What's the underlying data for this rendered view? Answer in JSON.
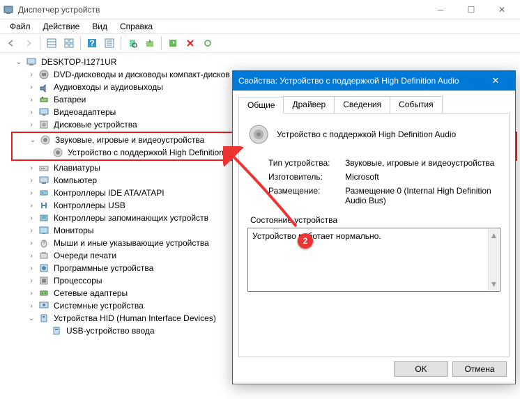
{
  "window": {
    "title": "Диспетчер устройств"
  },
  "menu": {
    "file": "Файл",
    "action": "Действие",
    "view": "Вид",
    "help": "Справка"
  },
  "tree": {
    "root": "DESKTOP-I1271UR",
    "items": [
      {
        "label": "DVD-дисководы и дисководы компакт-дисков"
      },
      {
        "label": "Аудиовходы и аудиовыходы"
      },
      {
        "label": "Батареи"
      },
      {
        "label": "Видеоадаптеры"
      },
      {
        "label": "Дисковые устройства"
      },
      {
        "label": "Звуковые, игровые и видеоустройства",
        "child": "Устройство с поддержкой High Definition Aud"
      },
      {
        "label": "Клавиатуры"
      },
      {
        "label": "Компьютер"
      },
      {
        "label": "Контроллеры IDE ATA/ATAPI"
      },
      {
        "label": "Контроллеры USB"
      },
      {
        "label": "Контроллеры запоминающих устройств"
      },
      {
        "label": "Мониторы"
      },
      {
        "label": "Мыши и иные указывающие устройства"
      },
      {
        "label": "Очереди печати"
      },
      {
        "label": "Программные устройства"
      },
      {
        "label": "Процессоры"
      },
      {
        "label": "Сетевые адаптеры"
      },
      {
        "label": "Системные устройства"
      },
      {
        "label": "Устройства HID (Human Interface Devices)",
        "child": "USB-устройство ввода"
      }
    ]
  },
  "dialog": {
    "title": "Свойства: Устройство с поддержкой High Definition Audio",
    "tabs": {
      "general": "Общие",
      "driver": "Драйвер",
      "details": "Сведения",
      "events": "События"
    },
    "device_name": "Устройство с поддержкой High Definition Audio",
    "props": {
      "type_k": "Тип устройства:",
      "type_v": "Звуковые, игровые и видеоустройства",
      "vendor_k": "Изготовитель:",
      "vendor_v": "Microsoft",
      "loc_k": "Размещение:",
      "loc_v": "Размещение 0 (Internal High Definition Audio Bus)"
    },
    "status_label": "Состояние устройства",
    "status_text": "Устройство работает нормально.",
    "ok": "OK",
    "cancel": "Отмена"
  },
  "badge": "2"
}
